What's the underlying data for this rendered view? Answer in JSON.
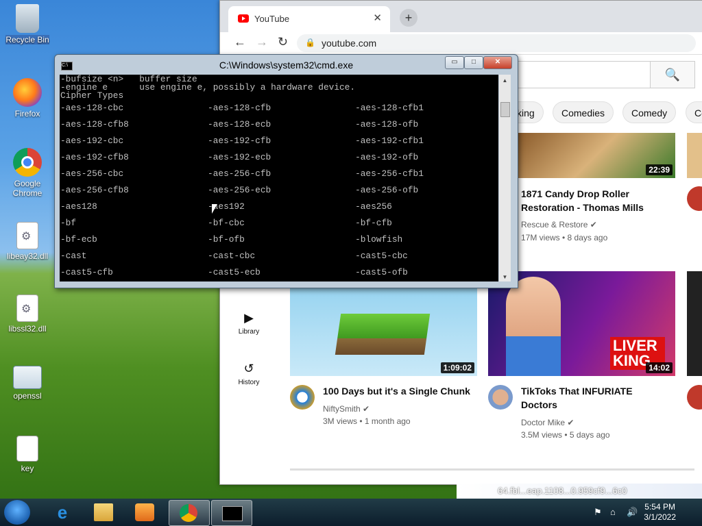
{
  "desktop": {
    "icons": [
      {
        "label": "Recycle Bin",
        "icon": "recycle-bin-icon"
      },
      {
        "label": "Firefox",
        "icon": "firefox-icon"
      },
      {
        "label": "Google Chrome",
        "icon": "chrome-icon"
      },
      {
        "label": "libeay32.dll",
        "icon": "dll-file-icon"
      },
      {
        "label": "libssl32.dll",
        "icon": "dll-file-icon"
      },
      {
        "label": "openssl",
        "icon": "openssl-icon"
      },
      {
        "label": "key",
        "icon": "file-icon"
      }
    ]
  },
  "browser": {
    "tab_title": "YouTube",
    "tab_close": "✕",
    "new_tab": "+",
    "url": "youtube.com",
    "back": "←",
    "forward": "→",
    "reload": "↻",
    "lock": "🔒",
    "search_icon": "🔍",
    "chips": [
      "king",
      "Comedies",
      "Comedy",
      "Co"
    ],
    "sidebar": [
      {
        "label": "Library",
        "icon": "library-icon"
      },
      {
        "label": "History",
        "icon": "history-icon"
      }
    ],
    "videos": [
      {
        "title": "1871 Candy Drop Roller Restoration - Thomas Mills",
        "channel": "Rescue & Restore",
        "meta": "17M views • 8 days ago",
        "duration": "22:39",
        "verified": true
      },
      {
        "title": "100 Days but it's a Single Chunk",
        "channel": "NiftySmith",
        "meta": "3M views • 1 month ago",
        "duration": "1:09:02",
        "verified": true
      },
      {
        "title": "TikToks That INFURIATE Doctors",
        "channel": "Doctor Mike",
        "meta": "3.5M views • 5 days ago",
        "duration": "14:02",
        "verified": true
      }
    ],
    "thumb_text": {
      "liver_king": "LIVER KING"
    }
  },
  "cmd": {
    "title": "C:\\Windows\\system32\\cmd.exe",
    "icon_text": "C:\\",
    "header_lines": [
      "-bufsize <n>   buffer size",
      "-engine e      use engine e, possibly a hardware device.",
      "Cipher Types"
    ],
    "cipher_rows": [
      [
        "-aes-128-cbc",
        "-aes-128-cfb",
        "-aes-128-cfb1"
      ],
      [
        "-aes-128-cfb8",
        "-aes-128-ecb",
        "-aes-128-ofb"
      ],
      [
        "-aes-192-cbc",
        "-aes-192-cfb",
        "-aes-192-cfb1"
      ],
      [
        "-aes-192-cfb8",
        "-aes-192-ecb",
        "-aes-192-ofb"
      ],
      [
        "-aes-256-cbc",
        "-aes-256-cfb",
        "-aes-256-cfb1"
      ],
      [
        "-aes-256-cfb8",
        "-aes-256-ecb",
        "-aes-256-ofb"
      ],
      [
        "-aes128",
        "-aes192",
        "-aes256"
      ],
      [
        "-bf",
        "-bf-cbc",
        "-bf-cfb"
      ],
      [
        "-bf-ecb",
        "-bf-ofb",
        "-blowfish"
      ],
      [
        "-cast",
        "-cast-cbc",
        "-cast5-cbc"
      ],
      [
        "-cast5-cfb",
        "-cast5-ecb",
        "-cast5-ofb"
      ]
    ],
    "buttons": {
      "minimize": "▭",
      "maximize": "□",
      "close": "✕"
    }
  },
  "background_strip": "64.fbl...eap.1108...0.959cf9...6c0",
  "taskbar": {
    "time": "5:54 PM",
    "date": "3/1/2022",
    "apps": [
      "windows-start-icon",
      "internet-explorer-icon",
      "file-explorer-icon",
      "media-player-icon",
      "chrome-icon",
      "cmd-icon"
    ]
  }
}
